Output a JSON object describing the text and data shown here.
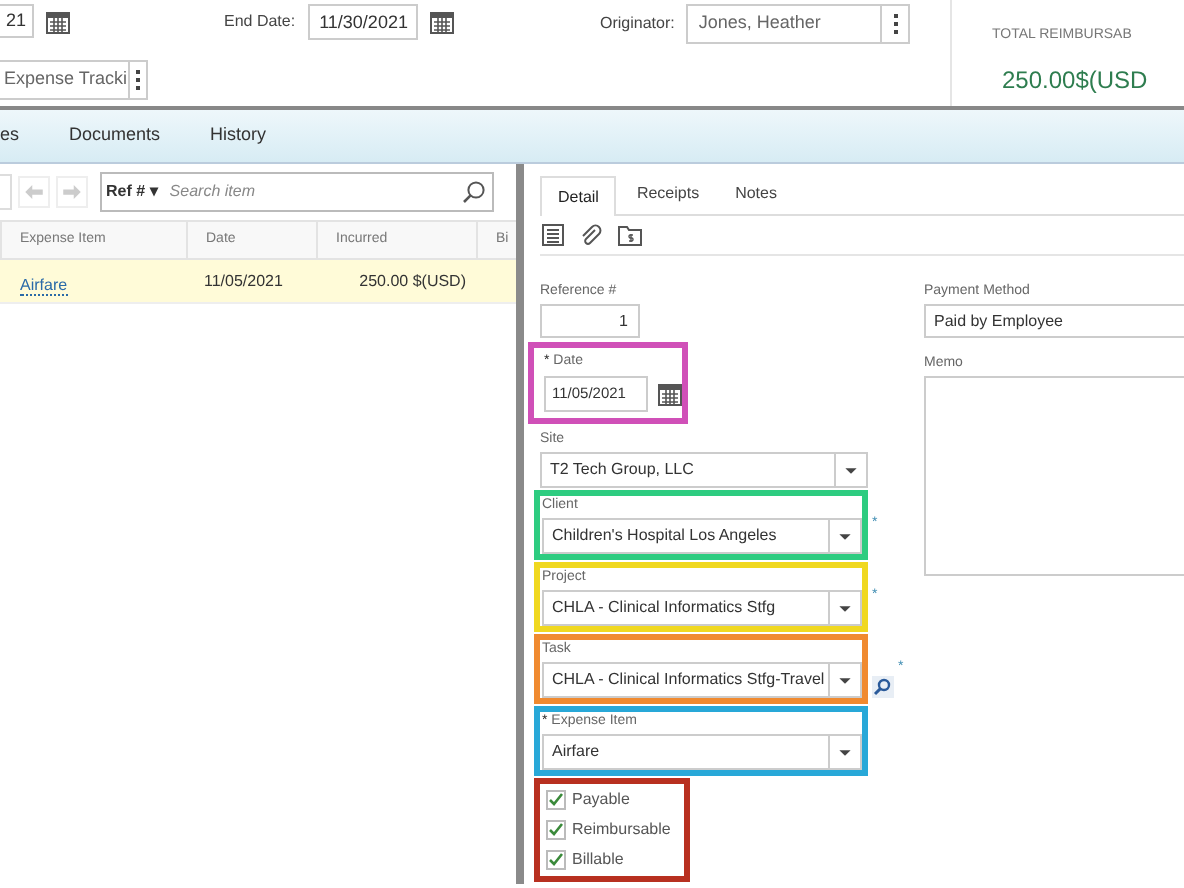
{
  "header": {
    "start_date": {
      "value": "21"
    },
    "end_date": {
      "label": "End Date:",
      "value": "11/30/2021"
    },
    "originator": {
      "label": "Originator:",
      "value": "Jones, Heather"
    },
    "template": {
      "value": "Expense Tracki"
    },
    "total": {
      "label": "TOTAL REIMBURSAB",
      "value": "250.00$(USD"
    }
  },
  "tabs": [
    {
      "label": "es",
      "selected": false
    },
    {
      "label": "Documents",
      "selected": false
    },
    {
      "label": "History",
      "selected": false
    }
  ],
  "list": {
    "sort": "Ref # ▾",
    "search_placeholder": "Search item",
    "columns": [
      "Expense Item",
      "Date",
      "Incurred",
      "Bi"
    ],
    "rows": [
      {
        "cells": [
          "Airfare",
          "11/05/2021",
          "250.00 $(USD)"
        ],
        "selected": true
      }
    ]
  },
  "detail_tabs": [
    {
      "label": "Detail",
      "selected": true
    },
    {
      "label": "Receipts",
      "selected": false
    },
    {
      "label": "Notes",
      "selected": false
    }
  ],
  "form": {
    "reference": {
      "label": "Reference #",
      "value": "1"
    },
    "date": {
      "label": "Date",
      "required": true,
      "value": "11/05/2021",
      "color": "#d050b8"
    },
    "site": {
      "label": "Site",
      "value": "T2 Tech Group, LLC"
    },
    "selects": [
      {
        "label": "Client",
        "value": "Children's Hospital Los Angeles",
        "required": false,
        "suffix": "*",
        "lookup": false,
        "color": "#2ecc80"
      },
      {
        "label": "Project",
        "value": "CHLA - Clinical Informatics Stfg",
        "required": false,
        "suffix": "*",
        "lookup": false,
        "color": "#f0d820"
      },
      {
        "label": "Task",
        "value": "CHLA - Clinical Informatics Stfg-Travel",
        "required": false,
        "suffix": "*",
        "lookup": true,
        "color": "#f08a30"
      },
      {
        "label": "Expense Item",
        "value": "Airfare",
        "required": true,
        "lookup": false,
        "color": "#28a8d8"
      }
    ],
    "checkboxes": {
      "color": "#b83020",
      "items": [
        {
          "label": "Payable",
          "checked": true
        },
        {
          "label": "Reimbursable",
          "checked": true
        },
        {
          "label": "Billable",
          "checked": true
        }
      ]
    },
    "payment_method": {
      "label": "Payment Method",
      "value": "Paid by Employee"
    },
    "memo": {
      "label": "Memo"
    }
  }
}
